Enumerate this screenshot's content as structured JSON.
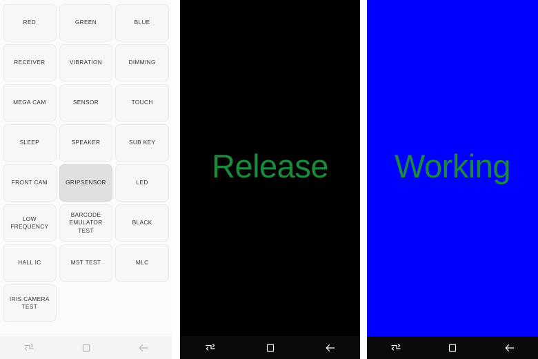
{
  "left_panel": {
    "name": "samsung-hidden-test-menu",
    "background": "#fbfbfb",
    "selected_item": "GRIPSENSOR",
    "grid": [
      {
        "label": "RED",
        "selected": false
      },
      {
        "label": "GREEN",
        "selected": false
      },
      {
        "label": "BLUE",
        "selected": false
      },
      {
        "label": "RECEIVER",
        "selected": false
      },
      {
        "label": "VIBRATION",
        "selected": false
      },
      {
        "label": "DIMMING",
        "selected": false
      },
      {
        "label": "MEGA CAM",
        "selected": false
      },
      {
        "label": "SENSOR",
        "selected": false
      },
      {
        "label": "TOUCH",
        "selected": false
      },
      {
        "label": "SLEEP",
        "selected": false
      },
      {
        "label": "SPEAKER",
        "selected": false
      },
      {
        "label": "SUB KEY",
        "selected": false
      },
      {
        "label": "FRONT CAM",
        "selected": false
      },
      {
        "label": "GRIPSENSOR",
        "selected": true
      },
      {
        "label": "LED",
        "selected": false
      },
      {
        "label": "LOW FREQUENCY",
        "selected": false
      },
      {
        "label": "BARCODE\nEMULATOR TEST",
        "selected": false
      },
      {
        "label": "BLACK",
        "selected": false
      },
      {
        "label": "HALL IC",
        "selected": false
      },
      {
        "label": "MST TEST",
        "selected": false
      },
      {
        "label": "MLC",
        "selected": false
      },
      {
        "label": "IRIS CAMERA TEST",
        "selected": false
      }
    ],
    "navbar": {
      "theme": "light",
      "recents_icon": "recents-icon",
      "home_icon": "home-icon",
      "back_icon": "back-icon"
    }
  },
  "middle_panel": {
    "name": "gripsensor-release-screen",
    "screen_background": "#000000",
    "status_text": "Release",
    "status_color": "#1a8a3c",
    "navbar": {
      "theme": "dark",
      "recents_icon": "recents-icon",
      "home_icon": "home-icon",
      "back_icon": "back-icon"
    }
  },
  "right_panel": {
    "name": "gripsensor-working-screen",
    "screen_background": "#0000ff",
    "status_text": "Working",
    "status_color": "#1a8a3c",
    "navbar": {
      "theme": "dark",
      "recents_icon": "recents-icon",
      "home_icon": "home-icon",
      "back_icon": "back-icon"
    }
  }
}
